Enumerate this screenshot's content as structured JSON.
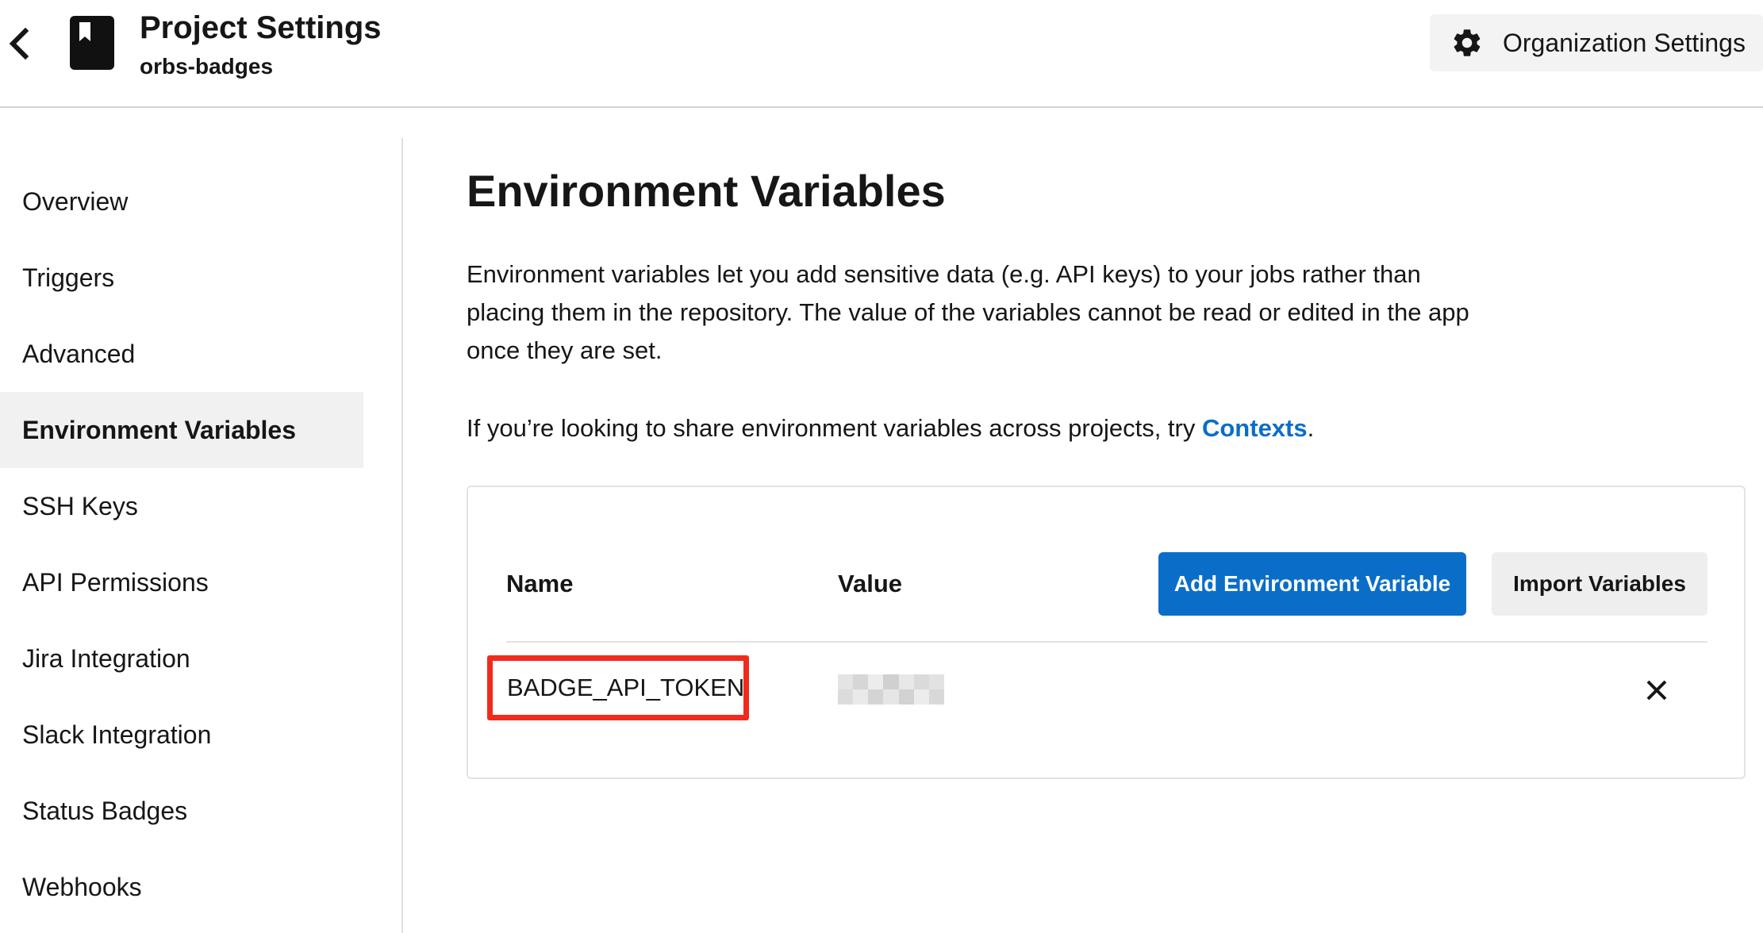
{
  "header": {
    "title": "Project Settings",
    "project_name": "orbs-badges",
    "org_settings_label": "Organization Settings",
    "icons": {
      "back": "chevron-left-icon",
      "project": "bookmark-book-icon",
      "settings": "gear-icon"
    }
  },
  "sidebar": {
    "items": [
      {
        "label": "Overview",
        "active": false
      },
      {
        "label": "Triggers",
        "active": false
      },
      {
        "label": "Advanced",
        "active": false
      },
      {
        "label": "Environment Variables",
        "active": true
      },
      {
        "label": "SSH Keys",
        "active": false
      },
      {
        "label": "API Permissions",
        "active": false
      },
      {
        "label": "Jira Integration",
        "active": false
      },
      {
        "label": "Slack Integration",
        "active": false
      },
      {
        "label": "Status Badges",
        "active": false
      },
      {
        "label": "Webhooks",
        "active": false
      }
    ]
  },
  "main": {
    "title": "Environment Variables",
    "description": "Environment variables let you add sensitive data (e.g. API keys) to your jobs rather than placing them in the repository. The value of the variables cannot be read or edited in the app once they are set.",
    "contexts_prefix": "If you’re looking to share environment variables across projects, try ",
    "contexts_link": "Contexts",
    "contexts_suffix": "."
  },
  "table": {
    "columns": {
      "name": "Name",
      "value": "Value"
    },
    "add_button": "Add Environment Variable",
    "import_button": "Import Variables",
    "rows": [
      {
        "name": "BADGE_API_TOKEN",
        "value_masked": true,
        "delete_icon": "close-icon"
      }
    ]
  },
  "colors": {
    "accent": "#0a6ec8",
    "highlight": "#f12b1c",
    "active_bg": "#f1f1f1"
  }
}
